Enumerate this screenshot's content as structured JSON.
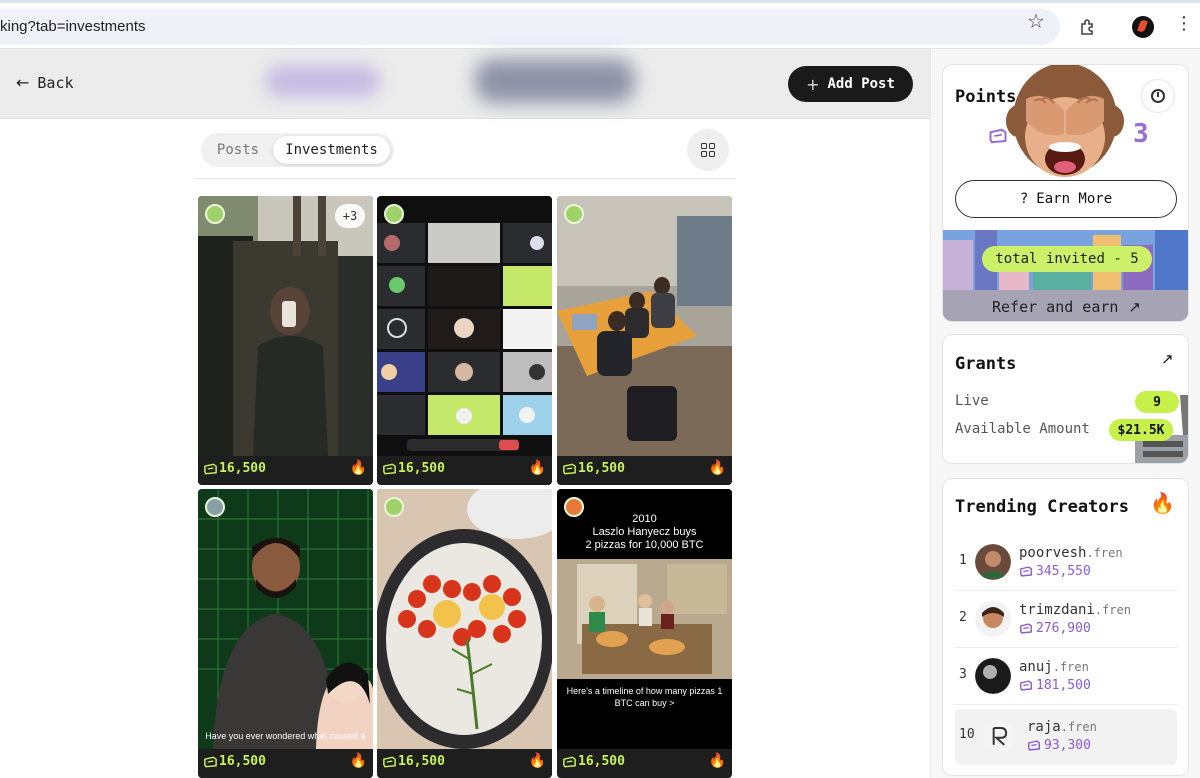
{
  "browser": {
    "url": "king?tab=investments"
  },
  "header": {
    "back_label": "Back",
    "add_post_label": "Add Post"
  },
  "tabs": {
    "posts": "Posts",
    "investments": "Investments"
  },
  "posts": [
    {
      "points": "16,500",
      "extra_badge": "+3"
    },
    {
      "points": "16,500"
    },
    {
      "points": "16,500"
    },
    {
      "points": "16,500",
      "caption": "Have you ever wondered what caused a"
    },
    {
      "points": "16,500"
    },
    {
      "points": "16,500",
      "caption_top": "2010\nLaszlo Hanyecz buys\n2 pizzas for 10,000 BTC",
      "caption_bottom": "Here's a timeline of how many pizzas 1 BTC can buy >"
    }
  ],
  "points_panel": {
    "title": "Points",
    "value": "3",
    "earn_more_label": "Earn More",
    "invited_label": "total invited - 5",
    "refer_label": "Refer and earn"
  },
  "grants": {
    "title": "Grants",
    "live_label": "Live",
    "live_value": "9",
    "amount_label": "Available Amount",
    "amount_value": "$21.5K"
  },
  "trending": {
    "title": "Trending Creators",
    "creators": [
      {
        "rank": "1",
        "name": "poorvesh",
        "suffix": ".fren",
        "points": "345,550"
      },
      {
        "rank": "2",
        "name": "trimzdani",
        "suffix": ".fren",
        "points": "276,900"
      },
      {
        "rank": "3",
        "name": "anuj",
        "suffix": ".fren",
        "points": "181,500"
      },
      {
        "rank": "10",
        "name": "raja",
        "suffix": ".fren",
        "points": "93,300"
      }
    ]
  },
  "colors": {
    "accent_lime": "#c8f25a",
    "points_purple": "#8a5bd0",
    "dark_button": "#1a1a1a"
  }
}
